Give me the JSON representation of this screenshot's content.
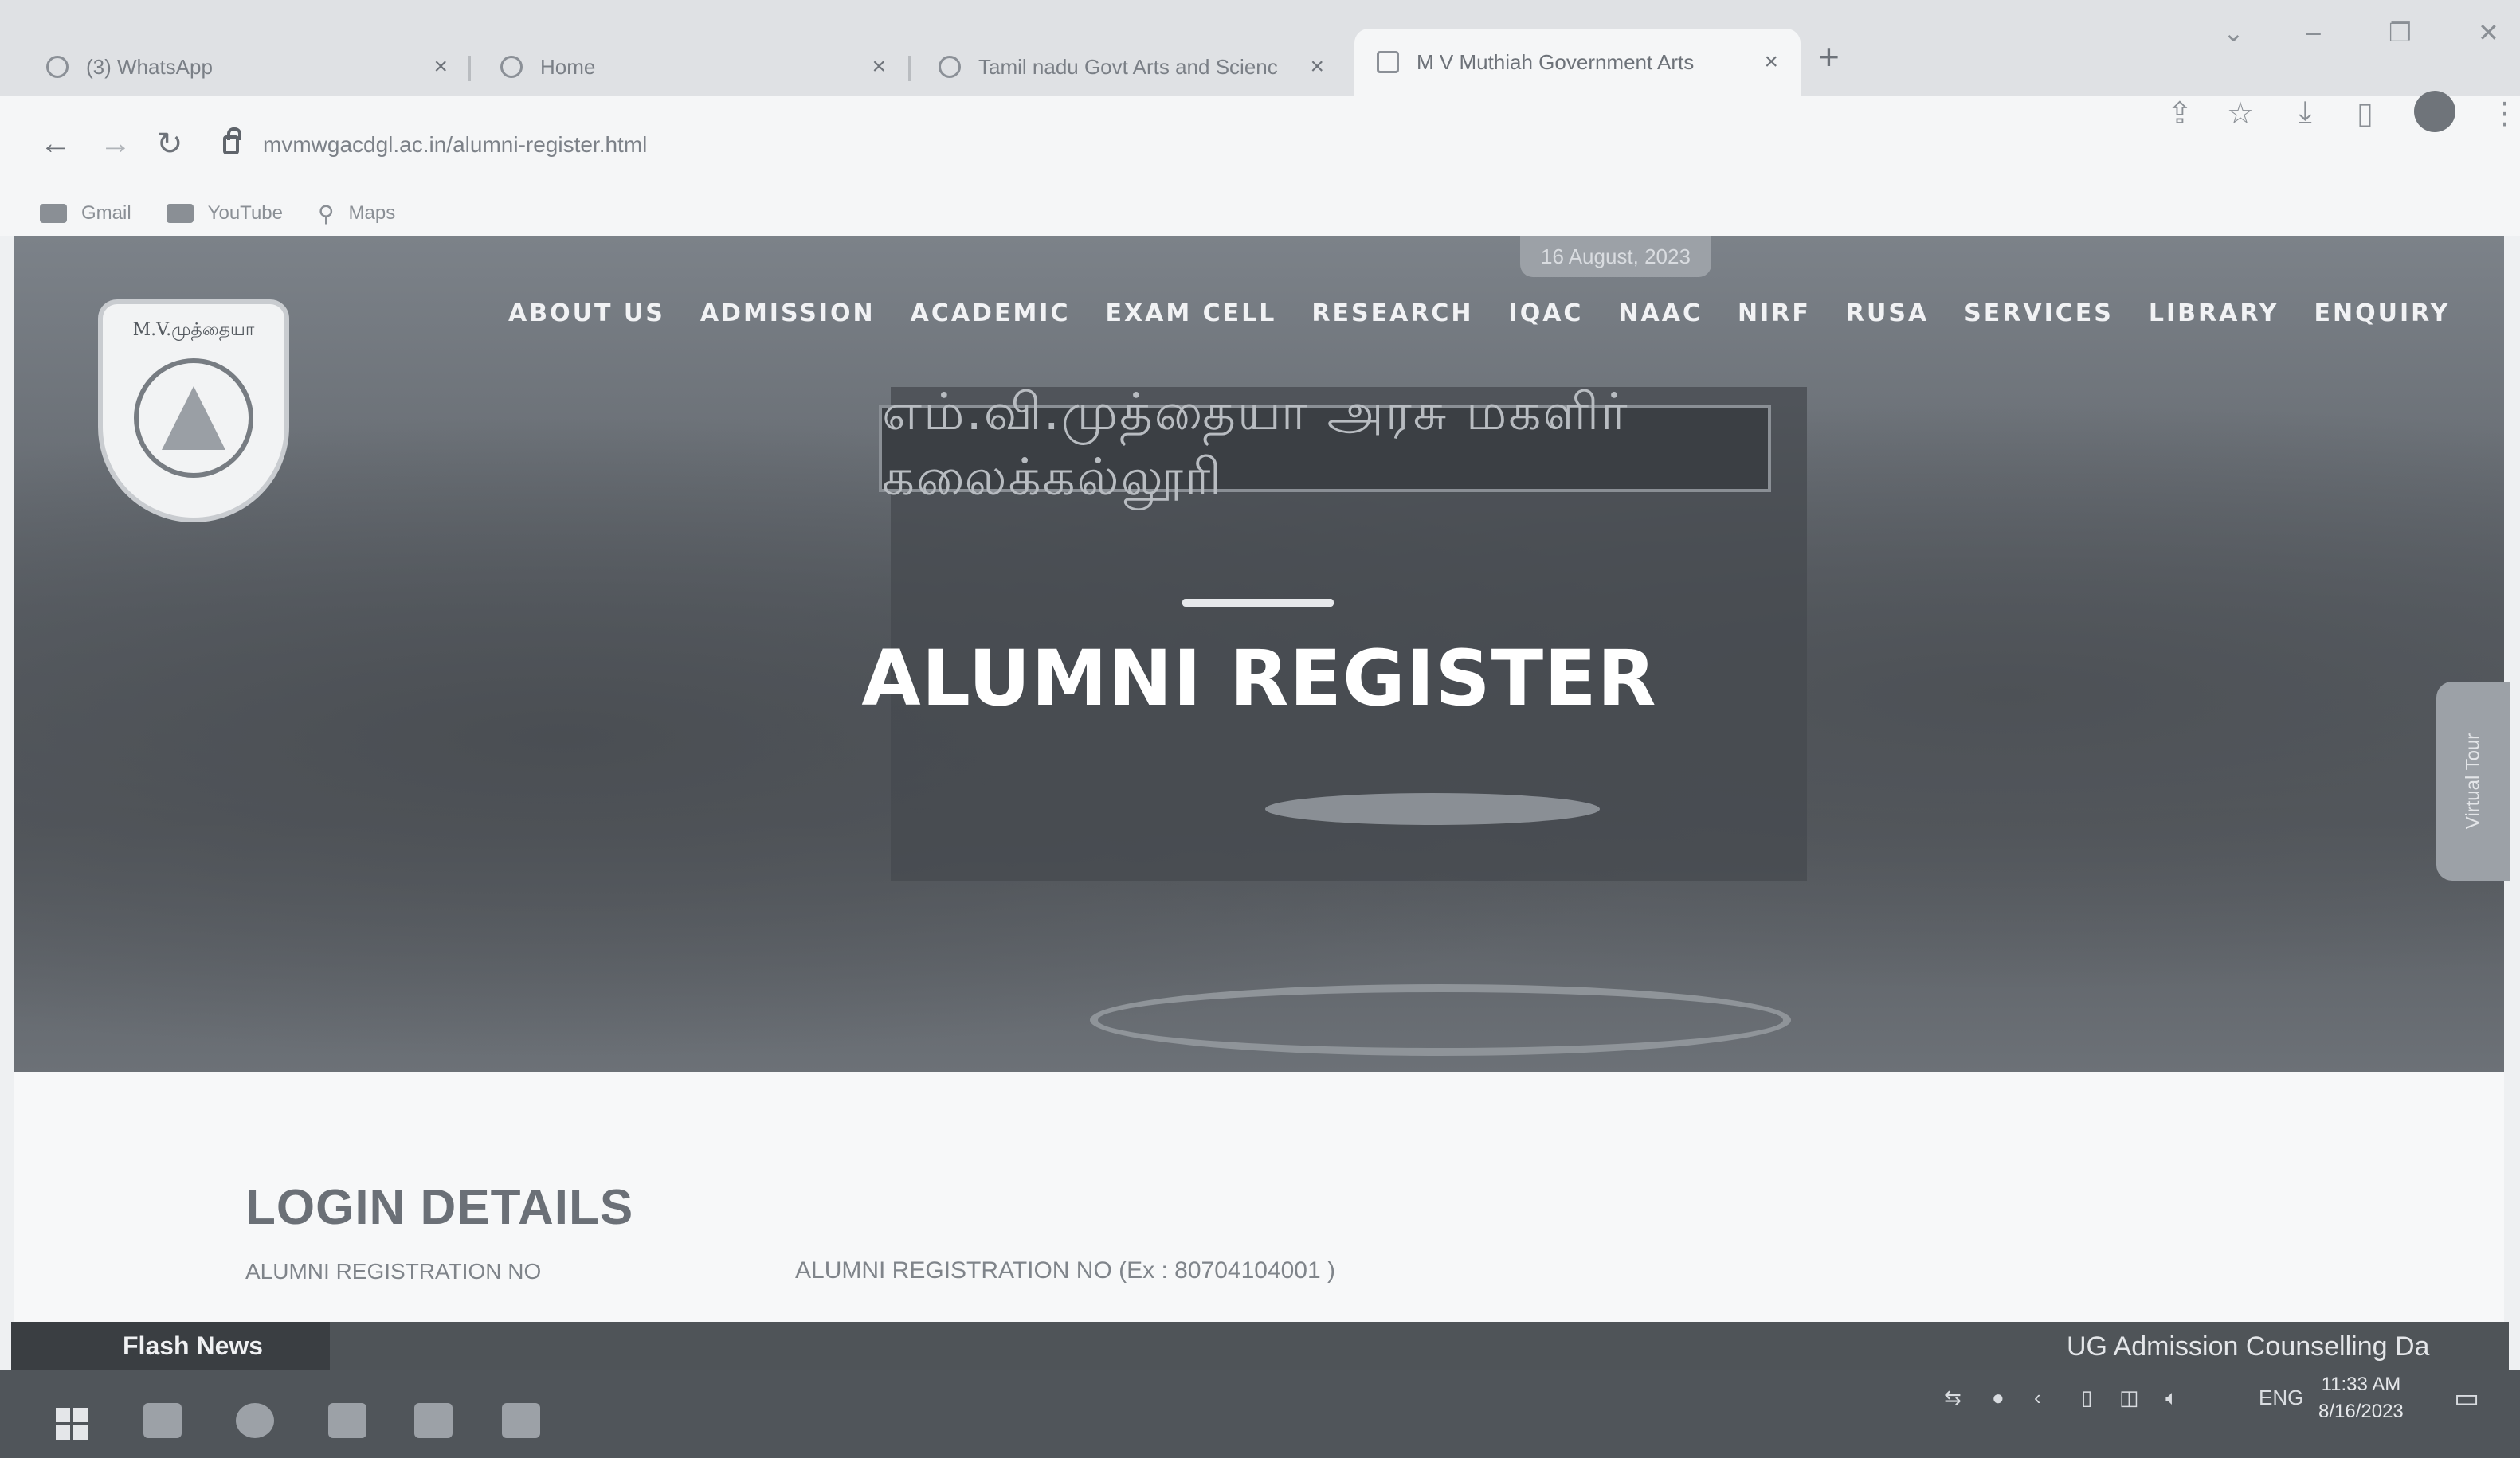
{
  "browser": {
    "tabs": [
      {
        "label": "(3) WhatsApp",
        "close": "×",
        "active": false
      },
      {
        "label": "Home",
        "close": "×",
        "active": false
      },
      {
        "label": "Tamil nadu Govt Arts and Scienc",
        "close": "×",
        "active": false
      },
      {
        "label": "M V Muthiah Government Arts",
        "close": "×",
        "active": true
      }
    ],
    "new_tab": "+",
    "url": "mvmwgacdgl.ac.in/alumni-register.html",
    "bookmarks": [
      {
        "label": "Gmail",
        "icon": "gmail-icon"
      },
      {
        "label": "YouTube",
        "icon": "youtube-icon"
      },
      {
        "label": "Maps",
        "icon": "maps-pin-icon"
      }
    ]
  },
  "site": {
    "date_badge": "16 August, 2023",
    "logo_text": "M.V.முத்தையா",
    "building_sign": "எம்.வி.முத்தையா அரசு மகளிர் கலைக்கல்லூரி",
    "nav": [
      "ABOUT US",
      "ADMISSION",
      "ACADEMIC",
      "EXAM CELL",
      "RESEARCH",
      "IQAC",
      "NAAC",
      "NIRF",
      "RUSA",
      "SERVICES",
      "LIBRARY",
      "ENQUIRY"
    ],
    "hero_title": "ALUMNI REGISTER",
    "virtual_tour": "Virtual Tour",
    "login": {
      "title": "LOGIN DETAILS",
      "reg_label": "ALUMNI REGISTRATION NO",
      "reg_placeholder": "ALUMNI REGISTRATION NO (Ex : 80704104001 )"
    },
    "flash": {
      "badge": "Flash News",
      "text": "UG Admission Counselling Da"
    }
  },
  "taskbar": {
    "lang": "ENG",
    "time": "11:33 AM",
    "date": "8/16/2023"
  },
  "colors": {
    "hero_overlay": "#5e6369",
    "taskbar": "#50555a",
    "flash_bar": "#4f5458"
  }
}
